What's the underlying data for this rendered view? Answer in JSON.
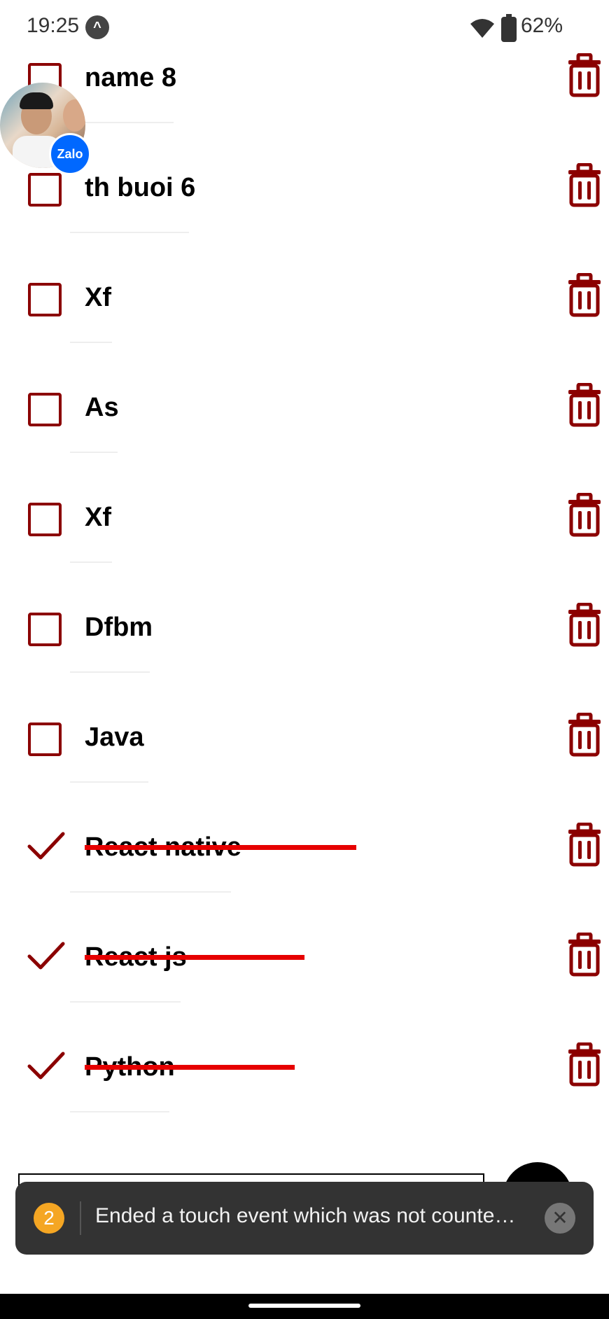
{
  "status_bar": {
    "time": "19:25",
    "battery_percent": "62%"
  },
  "todo_items": [
    {
      "label": "name 8",
      "completed": false
    },
    {
      "label": "th buoi 6",
      "completed": false
    },
    {
      "label": "Xf",
      "completed": false
    },
    {
      "label": "As",
      "completed": false
    },
    {
      "label": "Xf",
      "completed": false
    },
    {
      "label": "Dfbm",
      "completed": false
    },
    {
      "label": "Java",
      "completed": false
    },
    {
      "label": "React native",
      "completed": true
    },
    {
      "label": "React js",
      "completed": true
    },
    {
      "label": "Python",
      "completed": true
    }
  ],
  "chat_head": {
    "badge_text": "Zalo"
  },
  "toast": {
    "count": "2",
    "message": "Ended a touch event which was not counte…"
  },
  "colors": {
    "accent": "#8b0000",
    "strike": "#e60000",
    "toast_bg": "#333333"
  }
}
